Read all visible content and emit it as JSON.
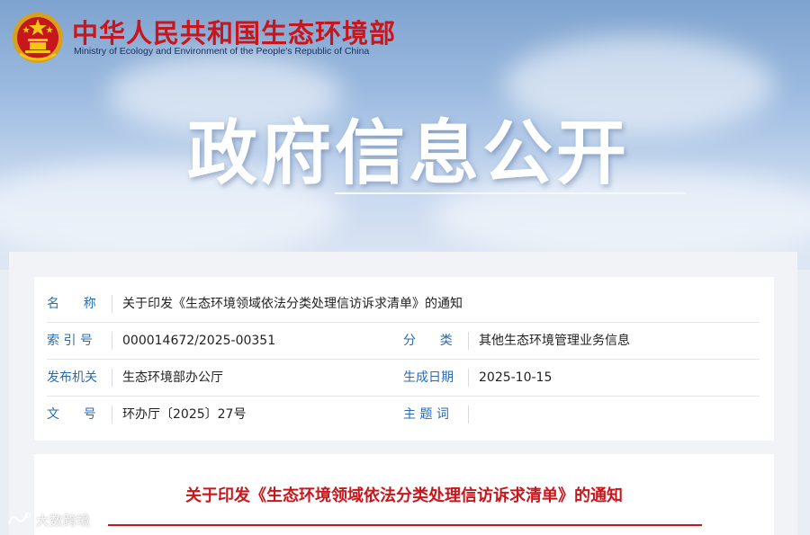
{
  "header": {
    "ministry_cn": "中华人民共和国生态环境部",
    "ministry_en": "Ministry of Ecology and Environment of the People's Republic of China",
    "emblem_icon": "national-emblem-icon",
    "hero_title": "政府信息公开"
  },
  "meta": {
    "name": {
      "label": "名      称",
      "value": "关于印发《生态环境领域依法分类处理信访诉求清单》的通知"
    },
    "index_no": {
      "label": "索 引 号",
      "value": "000014672/2025-00351"
    },
    "category": {
      "label": "分      类",
      "value": "其他生态环境管理业务信息"
    },
    "issuer": {
      "label": "发布机关",
      "value": "生态环境部办公厅"
    },
    "date": {
      "label": "生成日期",
      "value": "2025-10-15"
    },
    "doc_no": {
      "label": "文      号",
      "value": "环办厅〔2025〕27号"
    },
    "keywords": {
      "label": "主 题 词",
      "value": ""
    }
  },
  "document": {
    "title": "关于印发《生态环境领域依法分类处理信访诉求清单》的通知"
  },
  "watermark": {
    "text": "大数跨境"
  },
  "colors": {
    "brand_red": "#c8161d",
    "label_blue": "#2b6cb0"
  }
}
